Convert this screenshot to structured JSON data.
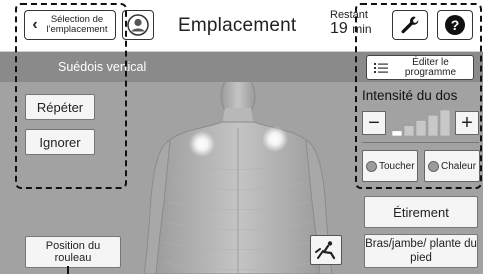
{
  "header": {
    "back_label": "Sélection de l'emplacement",
    "title": "Emplacement",
    "remaining_label": "Restant",
    "remaining_value": "19",
    "remaining_unit": "min"
  },
  "program_bar": {
    "name": "Suédois vertical",
    "edit_label": "Éditer le programme"
  },
  "left_panel": {
    "repeat_label": "Répéter",
    "skip_label": "Ignorer",
    "roller_position_label": "Position du rouleau"
  },
  "right_panel": {
    "intensity_label": "Intensité du dos",
    "minus_label": "−",
    "plus_label": "+",
    "intensity_level": 1,
    "intensity_max": 5,
    "touch_label": "Toucher",
    "heat_label": "Chaleur",
    "stretch_label": "Étirement",
    "limbs_label": "Bras/jambe/ plante du pied"
  },
  "colors": {
    "background": "#a2a2a2",
    "program_bar": "#8a8a8a",
    "button_face": "#f5f5f5",
    "highlight": "#ffffff"
  },
  "icons": {
    "back": "chevron-left-icon",
    "user": "user-avatar-icon",
    "settings": "wrench-icon",
    "help": "question-mark-icon",
    "edit": "list-icon",
    "recline": "recline-chair-icon"
  }
}
